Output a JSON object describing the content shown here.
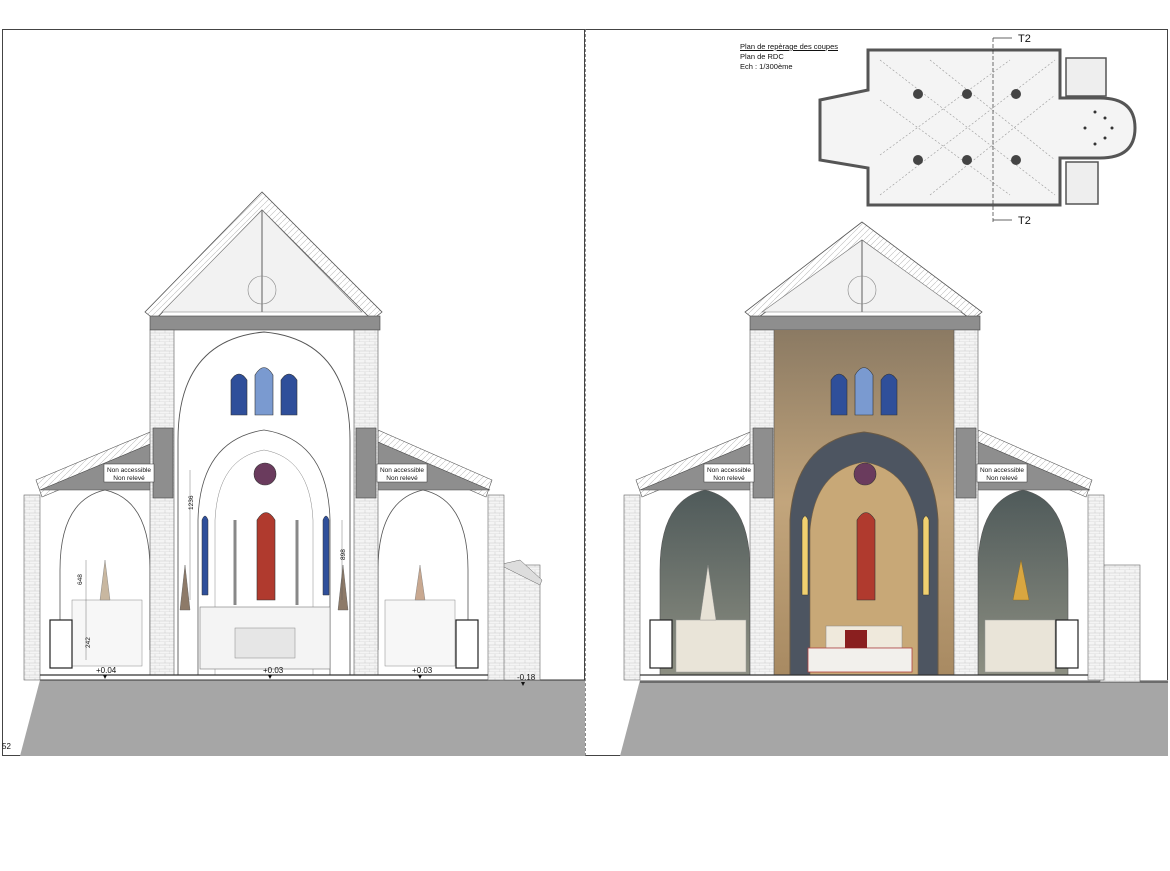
{
  "legend": {
    "title": "Plan de repèrage des coupes",
    "plan": "Plan de RDC",
    "scale": "Ech : 1/300ème"
  },
  "section_marker": "T2",
  "zones": {
    "left_note_1": "Non accessible",
    "left_note_2": "Non relevé",
    "right_note_1": "Non accessible",
    "right_note_2": "Non relevé"
  },
  "levels": {
    "left_aisle": "+0.04",
    "nave": "+0.03",
    "right_aisle": "+0.03",
    "exterior": "-0.18"
  },
  "dimensions": {
    "vertical_1": "1236",
    "vertical_2": "898",
    "vertical_3": "648",
    "vertical_4": "242"
  },
  "page_ref": "52",
  "colors": {
    "stone": "#9a9a9a",
    "ground": "#a6a6a6",
    "photo_warm": "#c9a878",
    "photo_dark": "#5e6a66",
    "glass_blue": "#2f4f9a",
    "glass_red": "#b03a2e"
  }
}
